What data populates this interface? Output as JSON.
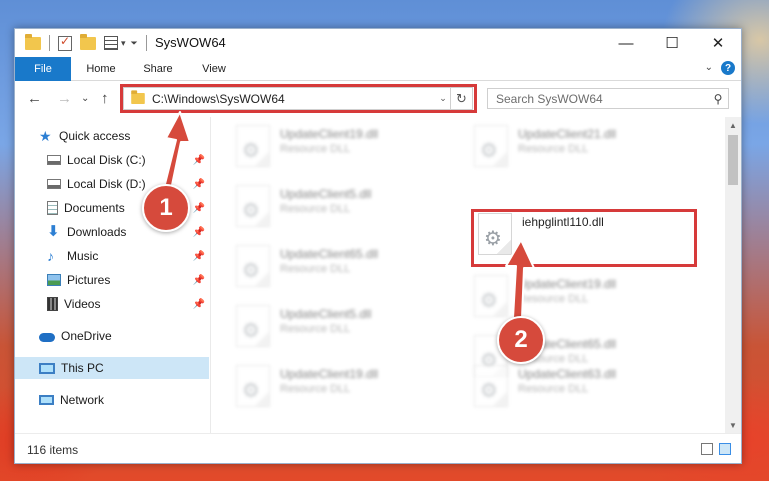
{
  "window": {
    "title": "SysWOW64",
    "controls": {
      "minimize": "—",
      "maximize": "☐",
      "close": "✕"
    }
  },
  "quick_access_toolbar": {
    "dropdown": "▾",
    "customize": "⏷"
  },
  "ribbon": {
    "tabs": [
      "File",
      "Home",
      "Share",
      "View"
    ],
    "expand": "⌄",
    "help": "?"
  },
  "address_bar": {
    "path": "C:\\Windows\\SysWOW64",
    "dropdown": "⌄",
    "refresh": "↻",
    "nav": {
      "back": "←",
      "forward": "→",
      "recent": "⌄",
      "up": "↑"
    }
  },
  "search": {
    "placeholder": "Search SysWOW64",
    "icon": "⚲"
  },
  "sidebar": {
    "items": [
      {
        "label": "Quick access",
        "icon": "star-icon",
        "pinned": false
      },
      {
        "label": "Local Disk (C:)",
        "icon": "drive-icon",
        "pinned": true
      },
      {
        "label": "Local Disk (D:)",
        "icon": "drive-icon",
        "pinned": true
      },
      {
        "label": "Documents",
        "icon": "documents-icon",
        "pinned": true
      },
      {
        "label": "Downloads",
        "icon": "downloads-icon",
        "pinned": true
      },
      {
        "label": "Music",
        "icon": "music-icon",
        "pinned": true
      },
      {
        "label": "Pictures",
        "icon": "pictures-icon",
        "pinned": true
      },
      {
        "label": "Videos",
        "icon": "videos-icon",
        "pinned": true
      },
      {
        "label": "OneDrive",
        "icon": "cloud-icon",
        "pinned": false
      },
      {
        "label": "This PC",
        "icon": "computer-icon",
        "pinned": false,
        "selected": true
      },
      {
        "label": "Network",
        "icon": "network-icon",
        "pinned": false
      }
    ],
    "pin_glyph": "📌"
  },
  "files": [
    {
      "name": "UpdateClient19.dll",
      "type": "Resource DLL",
      "blurred": true
    },
    {
      "name": "UpdateClient21.dll",
      "type": "Resource DLL",
      "blurred": true
    },
    {
      "name": "UpdateClient5.dll",
      "type": "Resource DLL",
      "blurred": true
    },
    {
      "name": "iehpglintl110.dll",
      "type": "",
      "blurred": false,
      "highlighted": true
    },
    {
      "name": "UpdateClient65.dll",
      "type": "Resource DLL",
      "blurred": true
    },
    {
      "name": "UpdateClient19.dll",
      "type": "Resource DLL",
      "blurred": true
    },
    {
      "name": "UpdateClient5.dll",
      "type": "Resource DLL",
      "blurred": true
    },
    {
      "name": "UpdateClient65.dll",
      "type": "Resource DLL",
      "blurred": true
    },
    {
      "name": "UpdateClient19.dll",
      "type": "Resource DLL",
      "blurred": true
    },
    {
      "name": "UpdateClient63.dll",
      "type": "Resource DLL",
      "blurred": true
    }
  ],
  "status_bar": {
    "item_count": "116 items"
  },
  "callouts": [
    "1",
    "2"
  ],
  "colors": {
    "accent": "#1979ca",
    "highlight": "#d63a3a",
    "callout": "#d64a3c",
    "selected": "#cde6f7"
  }
}
